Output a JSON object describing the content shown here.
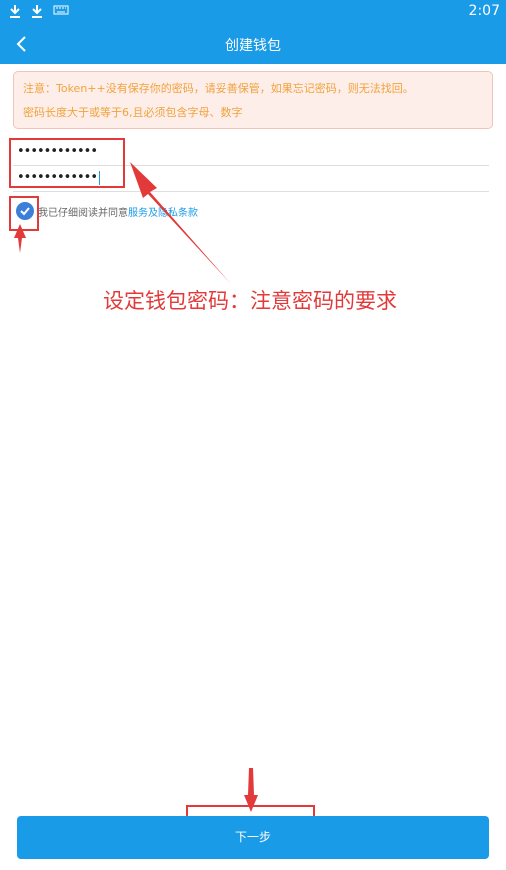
{
  "status_bar": {
    "time": "2:07",
    "icons": [
      "download-icon",
      "download-icon",
      "keyboard-icon"
    ]
  },
  "app_bar": {
    "title": "创建钱包",
    "back_icon": "chevron-left-icon"
  },
  "notice": {
    "line1": "注意：Token++没有保存你的密码，请妥善保管，如果忘记密码，则无法找回。",
    "line2": "密码长度大于或等于6,且必须包含字母、数字"
  },
  "password": {
    "value": "••••••••••••"
  },
  "confirm_password": {
    "value": "••••••••••••"
  },
  "agreement": {
    "checked": true,
    "text": "我已仔细阅读并同意",
    "link": "服务及隐私条款"
  },
  "annotation": {
    "text": "设定钱包密码：注意密码的要求"
  },
  "next_button": {
    "label": "下一步"
  },
  "colors": {
    "primary": "#1a9be8",
    "annotation": "#e23a3a",
    "notice_text": "#f2a23b"
  }
}
